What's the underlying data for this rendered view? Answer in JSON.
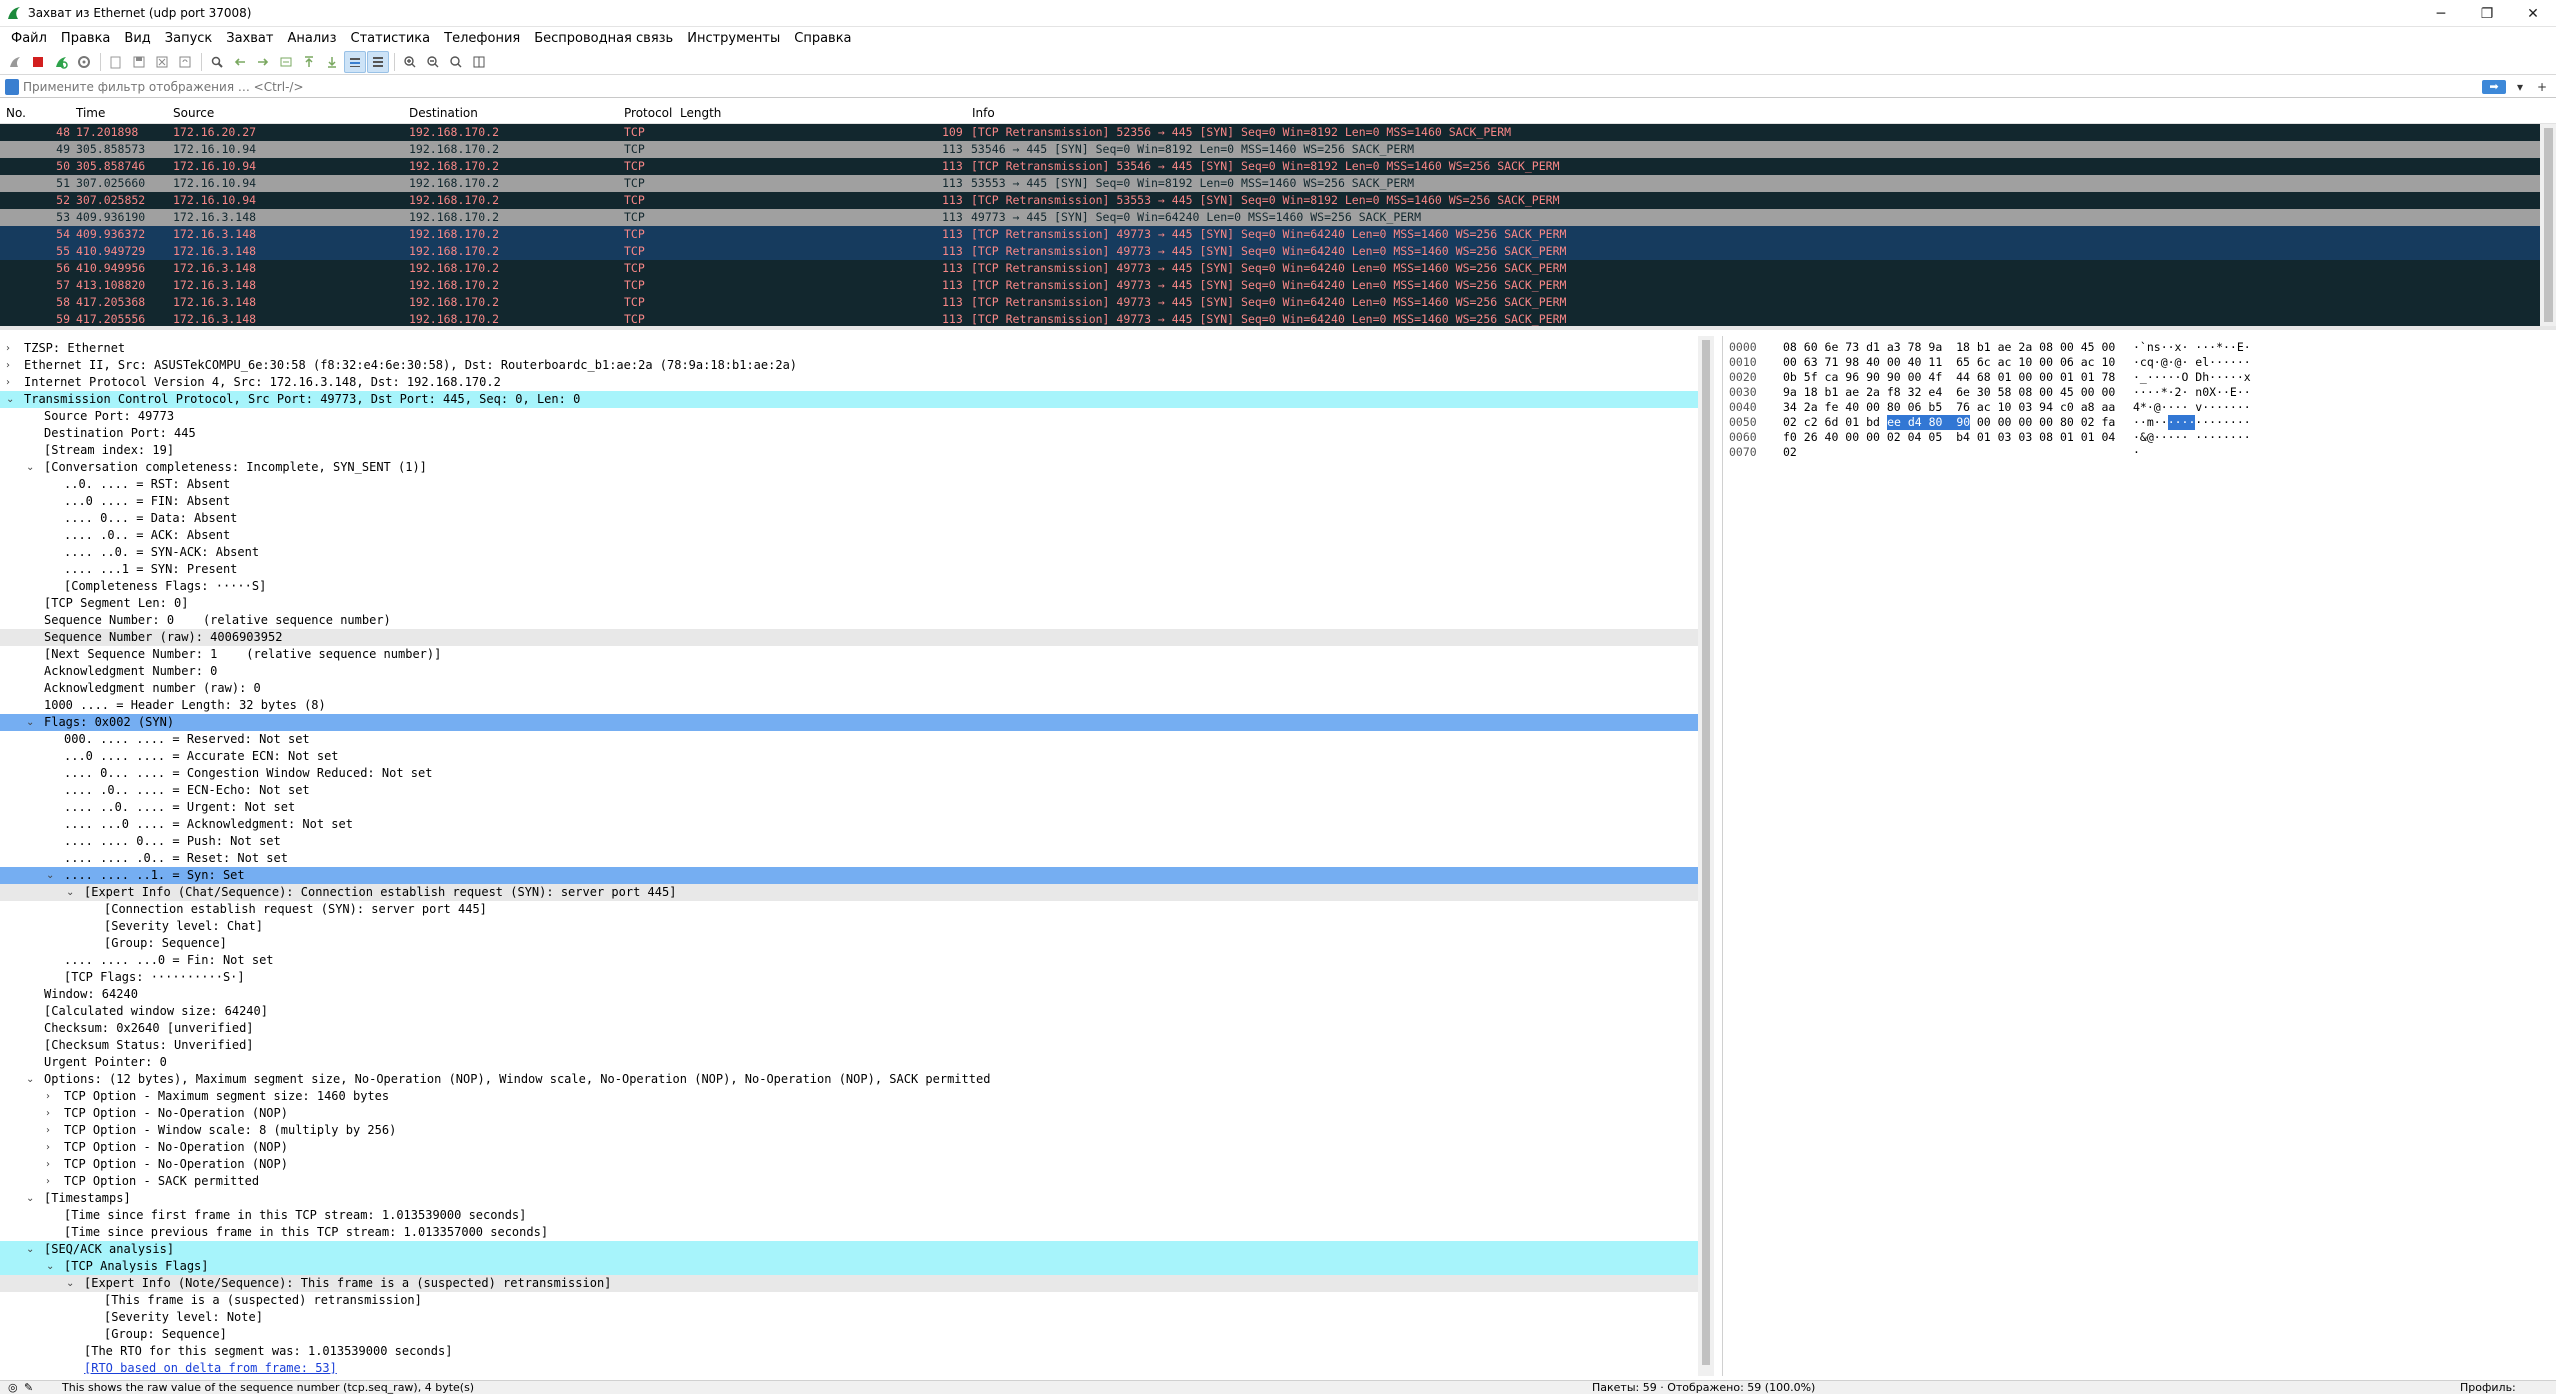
{
  "window": {
    "title": "Захват из Ethernet (udp port 37008)",
    "controls": [
      "─",
      "❐",
      "✕"
    ]
  },
  "menu": [
    "Файл",
    "Правка",
    "Вид",
    "Запуск",
    "Захват",
    "Анализ",
    "Статистика",
    "Телефония",
    "Беспроводная связь",
    "Инструменты",
    "Справка"
  ],
  "filter": {
    "placeholder": "Примените фильтр отображения … <Ctrl-/>",
    "apply_arrow": "➡",
    "dropdown": "▾",
    "add": "+"
  },
  "packet_list": {
    "columns": [
      "No.",
      "Time",
      "Source",
      "Destination",
      "Protocol",
      "Length",
      "Info"
    ],
    "rows": [
      {
        "no": "48",
        "time": "17.201898",
        "src": "172.16.20.27",
        "dst": "192.168.170.2",
        "proto": "TCP",
        "len": "109",
        "info": "[TCP Retransmission] 52356 → 445 [SYN] Seq=0 Win=8192 Len=0 MSS=1460 SACK_PERM",
        "style": "retx"
      },
      {
        "no": "49",
        "time": "305.858573",
        "src": "172.16.10.94",
        "dst": "192.168.170.2",
        "proto": "TCP",
        "len": "113",
        "info": "53546 → 445 [SYN] Seq=0 Win=8192 Len=0 MSS=1460 WS=256 SACK_PERM",
        "style": "syn"
      },
      {
        "no": "50",
        "time": "305.858746",
        "src": "172.16.10.94",
        "dst": "192.168.170.2",
        "proto": "TCP",
        "len": "113",
        "info": "[TCP Retransmission] 53546 → 445 [SYN] Seq=0 Win=8192 Len=0 MSS=1460 WS=256 SACK_PERM",
        "style": "retx"
      },
      {
        "no": "51",
        "time": "307.025660",
        "src": "172.16.10.94",
        "dst": "192.168.170.2",
        "proto": "TCP",
        "len": "113",
        "info": "53553 → 445 [SYN] Seq=0 Win=8192 Len=0 MSS=1460 WS=256 SACK_PERM",
        "style": "syn"
      },
      {
        "no": "52",
        "time": "307.025852",
        "src": "172.16.10.94",
        "dst": "192.168.170.2",
        "proto": "TCP",
        "len": "113",
        "info": "[TCP Retransmission] 53553 → 445 [SYN] Seq=0 Win=8192 Len=0 MSS=1460 WS=256 SACK_PERM",
        "style": "retx"
      },
      {
        "no": "53",
        "time": "409.936190",
        "src": "172.16.3.148",
        "dst": "192.168.170.2",
        "proto": "TCP",
        "len": "113",
        "info": "49773 → 445 [SYN] Seq=0 Win=64240 Len=0 MSS=1460 WS=256 SACK_PERM",
        "style": "syn"
      },
      {
        "no": "54",
        "time": "409.936372",
        "src": "172.16.3.148",
        "dst": "192.168.170.2",
        "proto": "TCP",
        "len": "113",
        "info": "[TCP Retransmission] 49773 → 445 [SYN] Seq=0 Win=64240 Len=0 MSS=1460 WS=256 SACK_PERM",
        "style": "sel"
      },
      {
        "no": "55",
        "time": "410.949729",
        "src": "172.16.3.148",
        "dst": "192.168.170.2",
        "proto": "TCP",
        "len": "113",
        "info": "[TCP Retransmission] 49773 → 445 [SYN] Seq=0 Win=64240 Len=0 MSS=1460 WS=256 SACK_PERM",
        "style": "sel"
      },
      {
        "no": "56",
        "time": "410.949956",
        "src": "172.16.3.148",
        "dst": "192.168.170.2",
        "proto": "TCP",
        "len": "113",
        "info": "[TCP Retransmission] 49773 → 445 [SYN] Seq=0 Win=64240 Len=0 MSS=1460 WS=256 SACK_PERM",
        "style": "retx"
      },
      {
        "no": "57",
        "time": "413.108820",
        "src": "172.16.3.148",
        "dst": "192.168.170.2",
        "proto": "TCP",
        "len": "113",
        "info": "[TCP Retransmission] 49773 → 445 [SYN] Seq=0 Win=64240 Len=0 MSS=1460 WS=256 SACK_PERM",
        "style": "retx"
      },
      {
        "no": "58",
        "time": "417.205368",
        "src": "172.16.3.148",
        "dst": "192.168.170.2",
        "proto": "TCP",
        "len": "113",
        "info": "[TCP Retransmission] 49773 → 445 [SYN] Seq=0 Win=64240 Len=0 MSS=1460 WS=256 SACK_PERM",
        "style": "retx"
      },
      {
        "no": "59",
        "time": "417.205556",
        "src": "172.16.3.148",
        "dst": "192.168.170.2",
        "proto": "TCP",
        "len": "113",
        "info": "[TCP Retransmission] 49773 → 445 [SYN] Seq=0 Win=64240 Len=0 MSS=1460 WS=256 SACK_PERM",
        "style": "retx"
      }
    ]
  },
  "details": [
    {
      "d": 0,
      "a": ">",
      "t": "TZSP: Ethernet"
    },
    {
      "d": 0,
      "a": ">",
      "t": "Ethernet II, Src: ASUSTekCOMPU_6e:30:58 (f8:32:e4:6e:30:58), Dst: Routerboardc_b1:ae:2a (78:9a:18:b1:ae:2a)"
    },
    {
      "d": 0,
      "a": ">",
      "t": "Internet Protocol Version 4, Src: 172.16.3.148, Dst: 192.168.170.2"
    },
    {
      "d": 0,
      "a": "v",
      "t": "Transmission Control Protocol, Src Port: 49773, Dst Port: 445, Seq: 0, Len: 0",
      "hl": "cyan"
    },
    {
      "d": 1,
      "a": "",
      "t": "Source Port: 49773"
    },
    {
      "d": 1,
      "a": "",
      "t": "Destination Port: 445"
    },
    {
      "d": 1,
      "a": "",
      "t": "[Stream index: 19]"
    },
    {
      "d": 1,
      "a": "v",
      "t": "[Conversation completeness: Incomplete, SYN_SENT (1)]"
    },
    {
      "d": 2,
      "a": "",
      "t": "..0. .... = RST: Absent"
    },
    {
      "d": 2,
      "a": "",
      "t": "...0 .... = FIN: Absent"
    },
    {
      "d": 2,
      "a": "",
      "t": ".... 0... = Data: Absent"
    },
    {
      "d": 2,
      "a": "",
      "t": ".... .0.. = ACK: Absent"
    },
    {
      "d": 2,
      "a": "",
      "t": ".... ..0. = SYN-ACK: Absent"
    },
    {
      "d": 2,
      "a": "",
      "t": ".... ...1 = SYN: Present"
    },
    {
      "d": 2,
      "a": "",
      "t": "[Completeness Flags: ·····S]"
    },
    {
      "d": 1,
      "a": "",
      "t": "[TCP Segment Len: 0]"
    },
    {
      "d": 1,
      "a": "",
      "t": "Sequence Number: 0    (relative sequence number)"
    },
    {
      "d": 1,
      "a": "",
      "t": "Sequence Number (raw): 4006903952",
      "hl": "gray"
    },
    {
      "d": 1,
      "a": "",
      "t": "[Next Sequence Number: 1    (relative sequence number)]"
    },
    {
      "d": 1,
      "a": "",
      "t": "Acknowledgment Number: 0"
    },
    {
      "d": 1,
      "a": "",
      "t": "Acknowledgment number (raw): 0"
    },
    {
      "d": 1,
      "a": "",
      "t": "1000 .... = Header Length: 32 bytes (8)"
    },
    {
      "d": 1,
      "a": "v",
      "t": "Flags: 0x002 (SYN)",
      "hl": "blue"
    },
    {
      "d": 2,
      "a": "",
      "t": "000. .... .... = Reserved: Not set"
    },
    {
      "d": 2,
      "a": "",
      "t": "...0 .... .... = Accurate ECN: Not set"
    },
    {
      "d": 2,
      "a": "",
      "t": ".... 0... .... = Congestion Window Reduced: Not set"
    },
    {
      "d": 2,
      "a": "",
      "t": ".... .0.. .... = ECN-Echo: Not set"
    },
    {
      "d": 2,
      "a": "",
      "t": ".... ..0. .... = Urgent: Not set"
    },
    {
      "d": 2,
      "a": "",
      "t": ".... ...0 .... = Acknowledgment: Not set"
    },
    {
      "d": 2,
      "a": "",
      "t": ".... .... 0... = Push: Not set"
    },
    {
      "d": 2,
      "a": "",
      "t": ".... .... .0.. = Reset: Not set"
    },
    {
      "d": 2,
      "a": "v",
      "t": ".... .... ..1. = Syn: Set",
      "hl": "blue"
    },
    {
      "d": 3,
      "a": "v",
      "t": "[Expert Info (Chat/Sequence): Connection establish request (SYN): server port 445]",
      "hl": "gray"
    },
    {
      "d": 4,
      "a": "",
      "t": "[Connection establish request (SYN): server port 445]"
    },
    {
      "d": 4,
      "a": "",
      "t": "[Severity level: Chat]"
    },
    {
      "d": 4,
      "a": "",
      "t": "[Group: Sequence]"
    },
    {
      "d": 2,
      "a": "",
      "t": ".... .... ...0 = Fin: Not set"
    },
    {
      "d": 2,
      "a": "",
      "t": "[TCP Flags: ··········S·]"
    },
    {
      "d": 1,
      "a": "",
      "t": "Window: 64240"
    },
    {
      "d": 1,
      "a": "",
      "t": "[Calculated window size: 64240]"
    },
    {
      "d": 1,
      "a": "",
      "t": "Checksum: 0x2640 [unverified]"
    },
    {
      "d": 1,
      "a": "",
      "t": "[Checksum Status: Unverified]"
    },
    {
      "d": 1,
      "a": "",
      "t": "Urgent Pointer: 0"
    },
    {
      "d": 1,
      "a": "v",
      "t": "Options: (12 bytes), Maximum segment size, No-Operation (NOP), Window scale, No-Operation (NOP), No-Operation (NOP), SACK permitted"
    },
    {
      "d": 2,
      "a": ">",
      "t": "TCP Option - Maximum segment size: 1460 bytes"
    },
    {
      "d": 2,
      "a": ">",
      "t": "TCP Option - No-Operation (NOP)"
    },
    {
      "d": 2,
      "a": ">",
      "t": "TCP Option - Window scale: 8 (multiply by 256)"
    },
    {
      "d": 2,
      "a": ">",
      "t": "TCP Option - No-Operation (NOP)"
    },
    {
      "d": 2,
      "a": ">",
      "t": "TCP Option - No-Operation (NOP)"
    },
    {
      "d": 2,
      "a": ">",
      "t": "TCP Option - SACK permitted"
    },
    {
      "d": 1,
      "a": "v",
      "t": "[Timestamps]"
    },
    {
      "d": 2,
      "a": "",
      "t": "[Time since first frame in this TCP stream: 1.013539000 seconds]"
    },
    {
      "d": 2,
      "a": "",
      "t": "[Time since previous frame in this TCP stream: 1.013357000 seconds]"
    },
    {
      "d": 1,
      "a": "v",
      "t": "[SEQ/ACK analysis]",
      "hl": "cyan"
    },
    {
      "d": 2,
      "a": "v",
      "t": "[TCP Analysis Flags]",
      "hl": "cyan"
    },
    {
      "d": 3,
      "a": "v",
      "t": "[Expert Info (Note/Sequence): This frame is a (suspected) retransmission]",
      "hl": "gray"
    },
    {
      "d": 4,
      "a": "",
      "t": "[This frame is a (suspected) retransmission]"
    },
    {
      "d": 4,
      "a": "",
      "t": "[Severity level: Note]"
    },
    {
      "d": 4,
      "a": "",
      "t": "[Group: Sequence]"
    },
    {
      "d": 3,
      "a": "",
      "t": "[The RTO for this segment was: 1.013539000 seconds]"
    },
    {
      "d": 3,
      "a": "",
      "t": "[RTO based on delta from frame: 53]",
      "link": true
    }
  ],
  "bytes": [
    {
      "off": "0000",
      "hex": "08 60 6e 73 d1 a3 78 9a  18 b1 ae 2a 08 00 45 00",
      "ascii": "·`ns··x· ···*··E·"
    },
    {
      "off": "0010",
      "hex": "00 63 71 98 40 00 40 11  65 6c ac 10 00 06 ac 10",
      "ascii": "·cq·@·@· el······"
    },
    {
      "off": "0020",
      "hex": "0b 5f ca 96 90 90 00 4f  44 68 01 00 00 01 01 78",
      "ascii": "·_·····O Dh·····x"
    },
    {
      "off": "0030",
      "hex": "9a 18 b1 ae 2a f8 32 e4  6e 30 58 08 00 45 00 00",
      "ascii": "····*·2· n0X··E··"
    },
    {
      "off": "0040",
      "hex": "34 2a fe 40 00 80 06 b5  76 ac 10 03 94 c0 a8 aa",
      "ascii": "4*·@···· v·······"
    },
    {
      "off": "0050",
      "hex": "02 c2 6d 01 bd ee d4 80  90 00 00 00 00 80 02 fa",
      "ascii": "··m····· ········",
      "hl": true
    },
    {
      "off": "0060",
      "hex": "f0 26 40 00 00 02 04 05  b4 01 03 03 08 01 01 04",
      "ascii": "·&@····· ········"
    },
    {
      "off": "0070",
      "hex": "02",
      "ascii": "·"
    }
  ],
  "bytes_highlight": {
    "hex": "ee d4 80  90",
    "ascii": "····"
  },
  "status": {
    "left": "This shows the raw value of the sequence number (tcp.seq_raw), 4 byte(s)",
    "middle": "Пакеты: 59 · Отображено: 59 (100.0%)",
    "right": "Профиль: Default"
  }
}
